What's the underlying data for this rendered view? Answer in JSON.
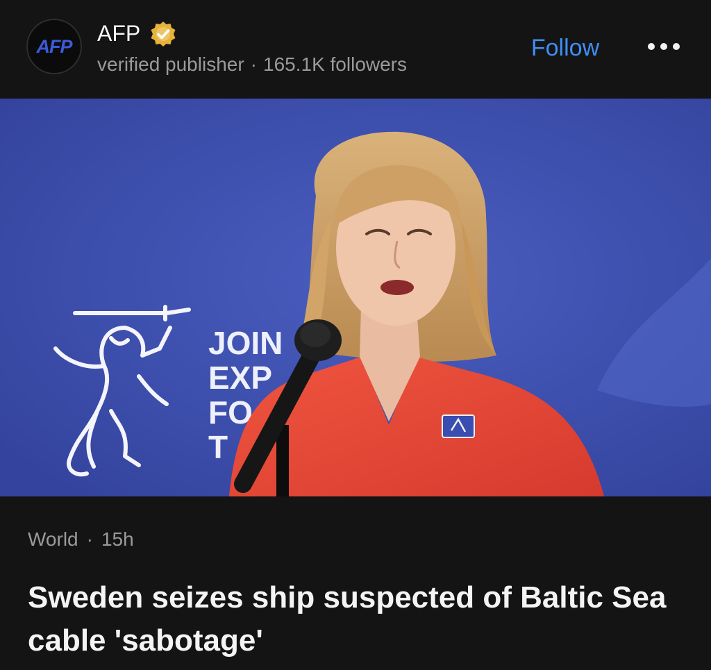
{
  "publisher": {
    "logo_text": "AFP",
    "name": "AFP",
    "badge": "verified publisher",
    "followers": "165.1K followers",
    "follow_label": "Follow"
  },
  "hero": {
    "backdrop_lines": [
      "JOIN",
      "EXP",
      "FO",
      "T"
    ]
  },
  "article": {
    "category": "World",
    "age": "15h",
    "headline": "Sweden seizes ship suspected of Baltic Sea cable 'sabotage'"
  },
  "colors": {
    "accent": "#3f8ef5",
    "verified_badge": "#e8b33a",
    "logo_blue": "#3b5bdb",
    "backdrop_blue": "#3f52b2",
    "jacket_red": "#e8493a"
  }
}
